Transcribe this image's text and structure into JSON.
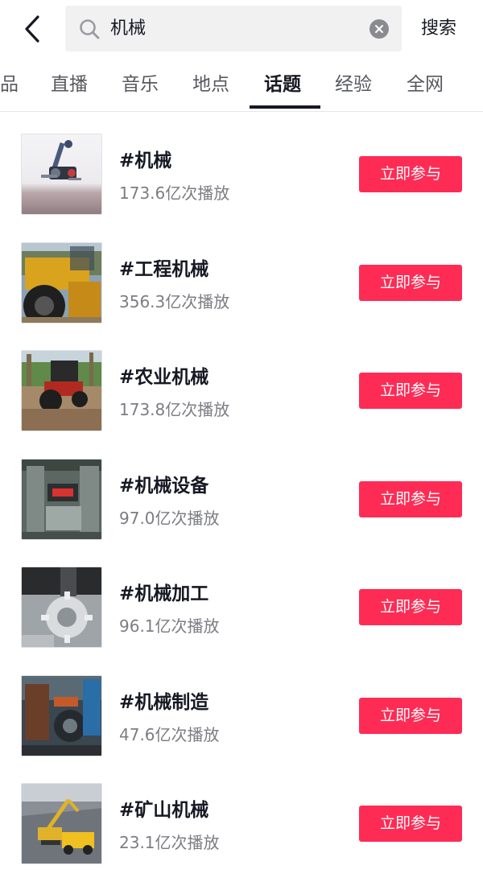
{
  "search": {
    "query": "机械",
    "submit_label": "搜索"
  },
  "tabs": [
    {
      "label": "品",
      "active": false
    },
    {
      "label": "直播",
      "active": false
    },
    {
      "label": "音乐",
      "active": false
    },
    {
      "label": "地点",
      "active": false
    },
    {
      "label": "话题",
      "active": true
    },
    {
      "label": "经验",
      "active": false
    },
    {
      "label": "全网",
      "active": false
    }
  ],
  "topics": [
    {
      "title": "#机械",
      "views": "173.6亿次播放",
      "button": "立即参与",
      "thumb": "machine-arm"
    },
    {
      "title": "#工程机械",
      "views": "356.3亿次播放",
      "button": "立即参与",
      "thumb": "loader"
    },
    {
      "title": "#农业机械",
      "views": "173.8亿次播放",
      "button": "立即参与",
      "thumb": "tractor"
    },
    {
      "title": "#机械设备",
      "views": "97.0亿次播放",
      "button": "立即参与",
      "thumb": "equipment"
    },
    {
      "title": "#机械加工",
      "views": "96.1亿次播放",
      "button": "立即参与",
      "thumb": "gear-part"
    },
    {
      "title": "#机械制造",
      "views": "47.6亿次播放",
      "button": "立即参与",
      "thumb": "workshop"
    },
    {
      "title": "#矿山机械",
      "views": "23.1亿次播放",
      "button": "立即参与",
      "thumb": "mining"
    }
  ],
  "colors": {
    "accent": "#fe2c55",
    "text_primary": "#161823",
    "text_secondary": "#7c7d83",
    "search_bg": "#f1f1f2"
  },
  "icons": {
    "back": "chevron-left-icon",
    "search": "search-icon",
    "clear": "clear-icon"
  }
}
